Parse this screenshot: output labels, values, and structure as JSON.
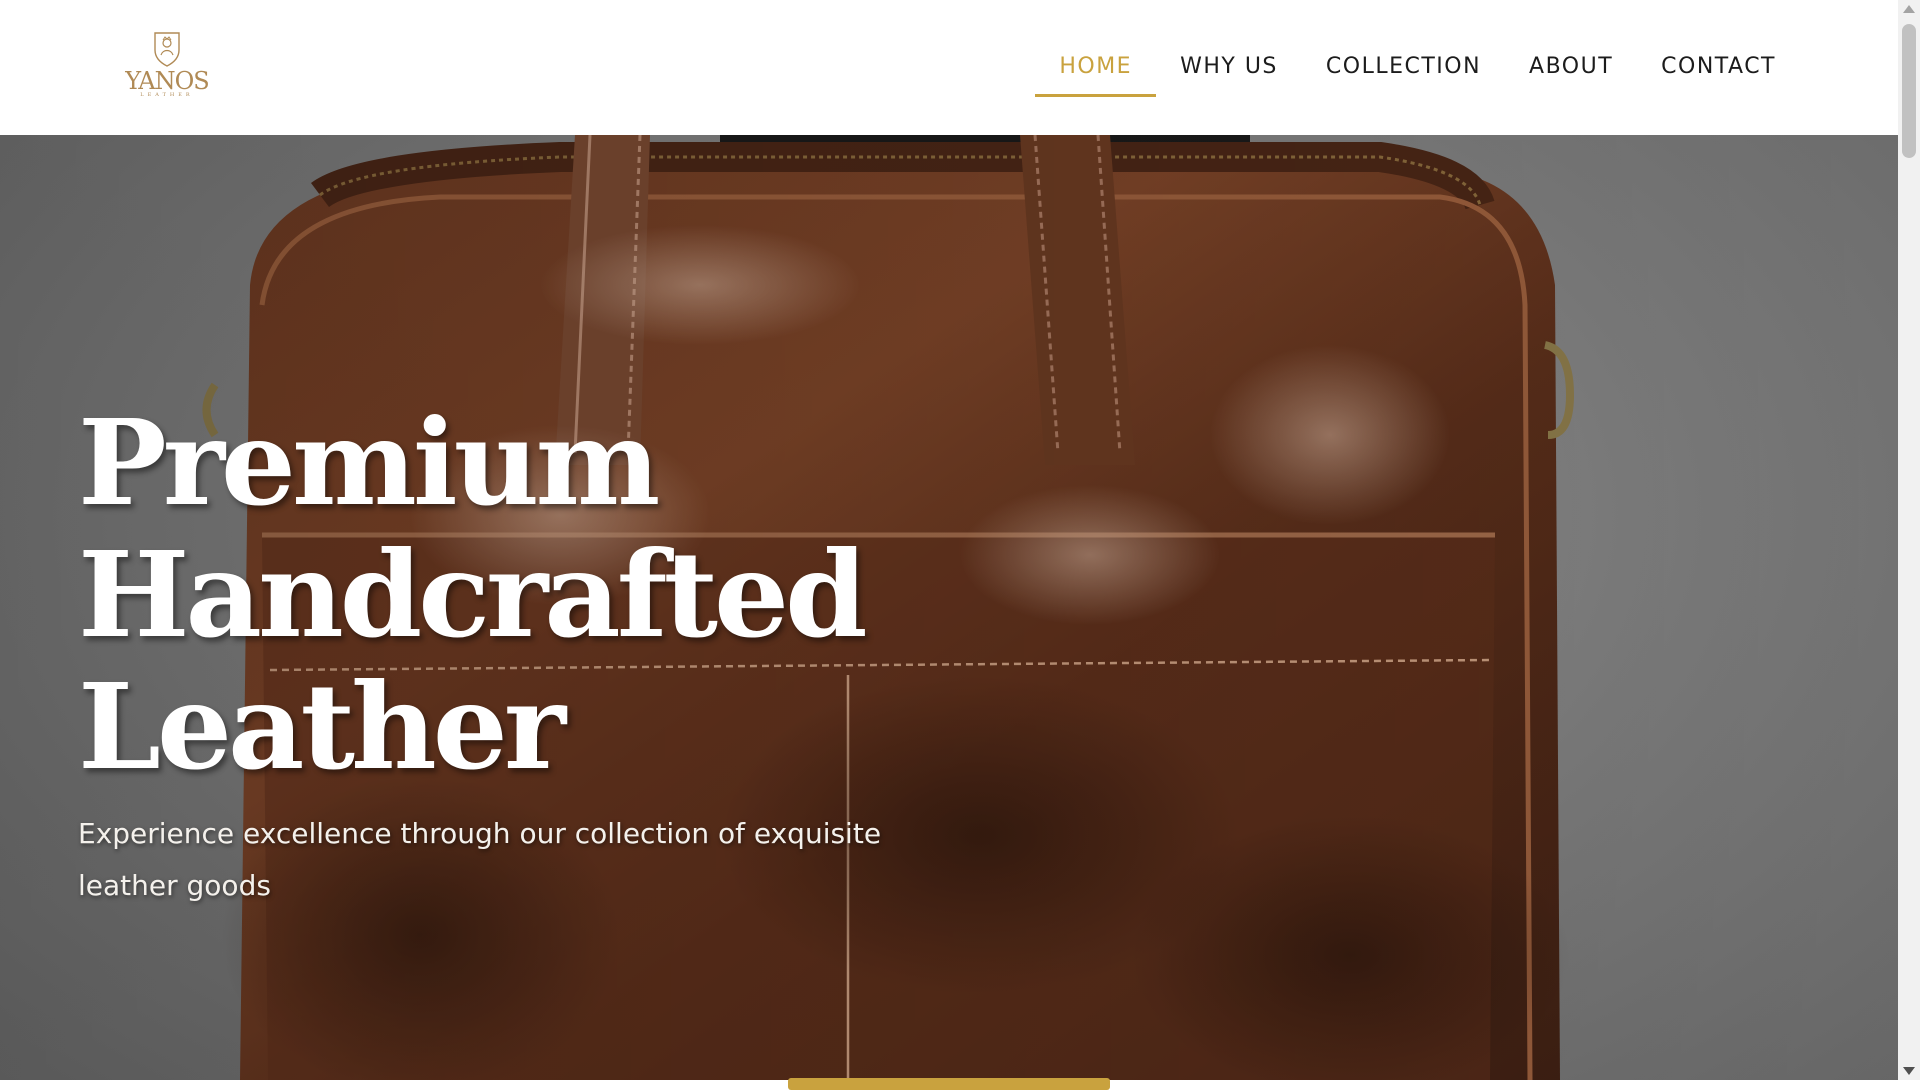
{
  "brand": {
    "name": "YANOS",
    "tagline": "LEATHER",
    "color": "#b08a55"
  },
  "nav": {
    "items": [
      {
        "label": "HOME",
        "active": true
      },
      {
        "label": "WHY US",
        "active": false
      },
      {
        "label": "COLLECTION",
        "active": false
      },
      {
        "label": "ABOUT",
        "active": false
      },
      {
        "label": "CONTACT",
        "active": false
      }
    ],
    "accent_color": "#c9a23e"
  },
  "hero": {
    "title": "Premium Handcrafted Leather",
    "subtitle": "Experience excellence through our collection of exquisite leather goods",
    "image": "brown-leather-briefcase"
  },
  "scrollbar": {
    "icons": [
      "scroll-up-arrow",
      "scroll-down-arrow"
    ]
  }
}
